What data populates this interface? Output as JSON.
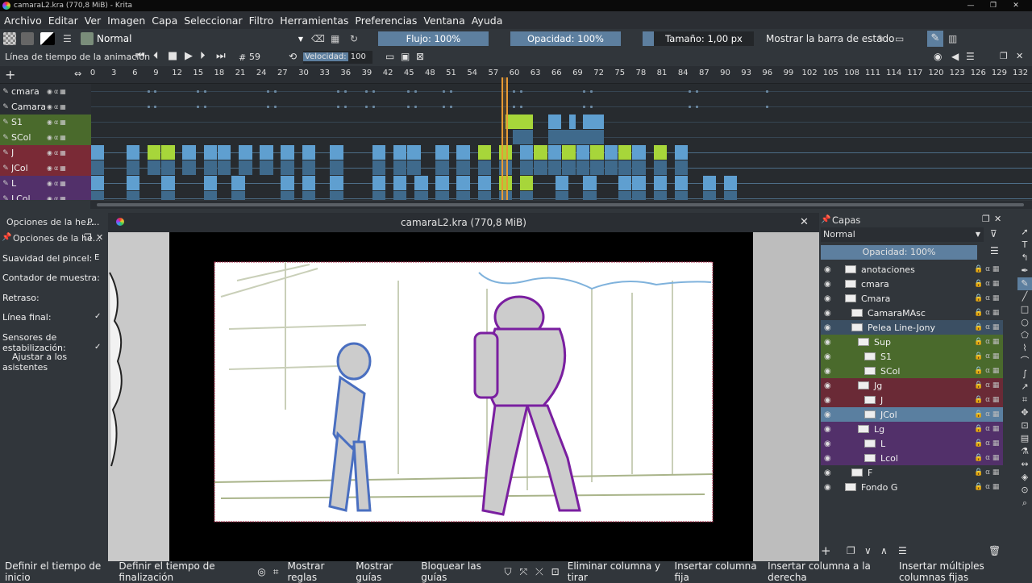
{
  "window": {
    "title": "camaraL2.kra (770,8 MiB) - Krita"
  },
  "menu": [
    "Archivo",
    "Editar",
    "Ver",
    "Imagen",
    "Capa",
    "Seleccionar",
    "Filtro",
    "Herramientas",
    "Preferencias",
    "Ventana",
    "Ayuda"
  ],
  "toolbar": {
    "blend_mode": "Normal",
    "flow": "Flujo: 100%",
    "opacity": "Opacidad: 100%",
    "size": "Tamaño: 1,00 px",
    "statusbar_toggle": "Mostrar la barra de estado"
  },
  "timeline": {
    "title": "Línea de tiempo de la animación",
    "frame_hash": "#",
    "frame": "59",
    "speed_label": "Velocidad:",
    "speed": "100 %",
    "ruler": [
      "0",
      "3",
      "6",
      "9",
      "12",
      "15",
      "18",
      "21",
      "24",
      "27",
      "30",
      "33",
      "36",
      "39",
      "42",
      "45",
      "48",
      "51",
      "54",
      "57",
      "60",
      "63",
      "66",
      "69",
      "72",
      "75",
      "78",
      "81",
      "84",
      "87",
      "90",
      "93",
      "96",
      "99",
      "102",
      "105",
      "108",
      "111",
      "114",
      "117",
      "120",
      "123",
      "126",
      "129",
      "132"
    ],
    "layers": [
      {
        "name": "cmara",
        "color": "#2a2e33"
      },
      {
        "name": "CamaraMAsc",
        "color": "#2a2e33"
      },
      {
        "name": "S1",
        "color": "#4a6a2c"
      },
      {
        "name": "SCol",
        "color": "#4a6a2c"
      },
      {
        "name": "J",
        "color": "#7a2a36"
      },
      {
        "name": "JCol",
        "color": "#7a2a36"
      },
      {
        "name": "L",
        "color": "#52306a"
      },
      {
        "name": "LCol",
        "color": "#52306a"
      }
    ]
  },
  "left_dock": {
    "tab1": "Opciones de la he...",
    "tab2": "P...",
    "panel_title": "Opciones de la he...",
    "options": [
      {
        "label": "Suavidad del pincel:",
        "value": "E"
      },
      {
        "label": "Contador de muestra:",
        "value": ""
      },
      {
        "label": "Retraso:",
        "value": ""
      },
      {
        "label": "Línea final:",
        "value": "✓"
      },
      {
        "label": "Sensores de estabilización:",
        "value": "✓"
      },
      {
        "label": "Ajustar a los asistentes",
        "value": ""
      }
    ]
  },
  "document": {
    "tab": "camaraL2.kra (770,8 MiB)"
  },
  "layers_panel": {
    "title": "Capas",
    "blend": "Normal",
    "opacity": "Opacidad: 100%",
    "items": [
      {
        "name": "anotaciones",
        "indent": 0,
        "color": "#31363b"
      },
      {
        "name": "cmara",
        "indent": 0,
        "color": "#31363b"
      },
      {
        "name": "Cmara",
        "indent": 0,
        "color": "#31363b"
      },
      {
        "name": "CamaraMAsc",
        "indent": 1,
        "color": "#31363b"
      },
      {
        "name": "Pelea Line-Jony",
        "indent": 1,
        "color": "#3b4f63"
      },
      {
        "name": "Sup",
        "indent": 2,
        "color": "#4a6a2c"
      },
      {
        "name": "S1",
        "indent": 3,
        "color": "#4a6a2c"
      },
      {
        "name": "SCol",
        "indent": 3,
        "color": "#4a6a2c"
      },
      {
        "name": "Jg",
        "indent": 2,
        "color": "#6a2a36"
      },
      {
        "name": "J",
        "indent": 3,
        "color": "#6a2a36"
      },
      {
        "name": "JCol",
        "indent": 3,
        "color": "#5a7fa0"
      },
      {
        "name": "Lg",
        "indent": 2,
        "color": "#52306a"
      },
      {
        "name": "L",
        "indent": 3,
        "color": "#52306a"
      },
      {
        "name": "Lcol",
        "indent": 3,
        "color": "#52306a"
      },
      {
        "name": "F",
        "indent": 1,
        "color": "#31363b"
      },
      {
        "name": "Fondo G",
        "indent": 0,
        "color": "#31363b"
      }
    ]
  },
  "statusbar": {
    "items": [
      "Definir el tiempo de inicio",
      "Definir el tiempo de finalización",
      "Mostrar reglas",
      "Mostrar guías",
      "Bloquear las guías",
      "Eliminar columna y tirar",
      "Insertar columna fija",
      "Insertar columna a la derecha",
      "Insertar múltiples columnas fijas"
    ]
  }
}
